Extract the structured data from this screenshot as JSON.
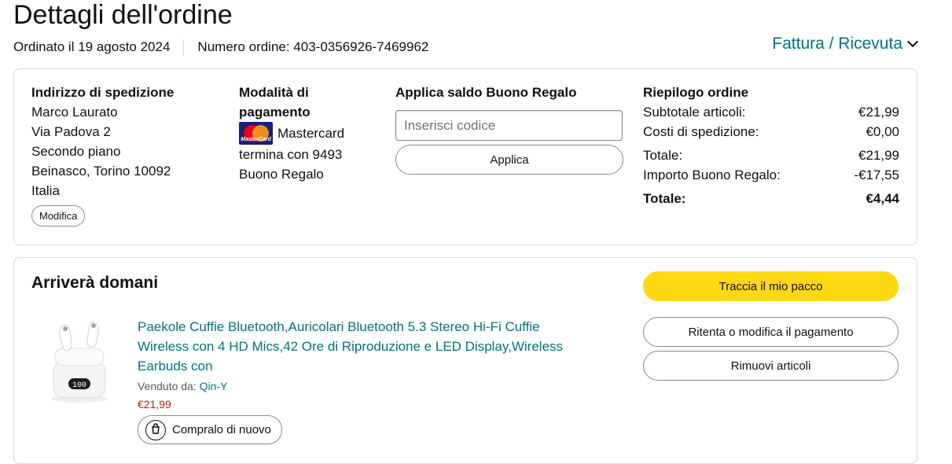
{
  "header": {
    "title": "Dettagli dell'ordine",
    "ordered_on": "Ordinato il 19 agosto 2024",
    "order_number": "Numero ordine: 403-0356926-7469962",
    "invoice_link": "Fattura / Ricevuta"
  },
  "shipping": {
    "title": "Indirizzo di spedizione",
    "lines": [
      "Marco Laurato",
      "Via Padova 2",
      "Secondo piano",
      "Beinasco, Torino 10092",
      "Italia"
    ],
    "edit_label": "Modifica"
  },
  "payment": {
    "title": "Modalità di pagamento",
    "card_brand": "Mastercard",
    "logo_text": "MasterCard",
    "card_ending": "termina con 9493",
    "extra": "Buono Regalo"
  },
  "gift_card": {
    "title": "Applica saldo Buono Regalo",
    "input_placeholder": "Inserisci codice",
    "apply_label": "Applica"
  },
  "summary": {
    "title": "Riepilogo ordine",
    "rows": [
      {
        "label": "Subtotale articoli:",
        "value": "€21,99"
      },
      {
        "label": "Costi di spedizione:",
        "value": "€0,00"
      },
      {
        "label": "Totale:",
        "value": "€21,99"
      },
      {
        "label": "Importo Buono Regalo:",
        "value": "-€17,55"
      }
    ],
    "total_label": "Totale:",
    "total_value": "€4,44"
  },
  "shipment": {
    "arrival": "Arriverà domani",
    "product_title": "Paekole Cuffie Bluetooth,Auricolari Bluetooth 5.3 Stereo Hi-Fi Cuffie Wireless con 4 HD Mics,42 Ore di Riproduzione e LED Display,Wireless Earbuds con",
    "sold_by_label": "Venduto da:",
    "seller": "Qin-Y",
    "price": "€21,99",
    "buy_again_label": "Compralo di nuovo",
    "case_display": "100",
    "track_label": "Traccia il mio pacco",
    "retry_label": "Ritenta o modifica il pagamento",
    "remove_label": "Rimuovi articoli"
  },
  "colors": {
    "link": "#007185",
    "price": "#b12704",
    "primary_button": "#ffd814",
    "border": "#d5d9d9"
  }
}
